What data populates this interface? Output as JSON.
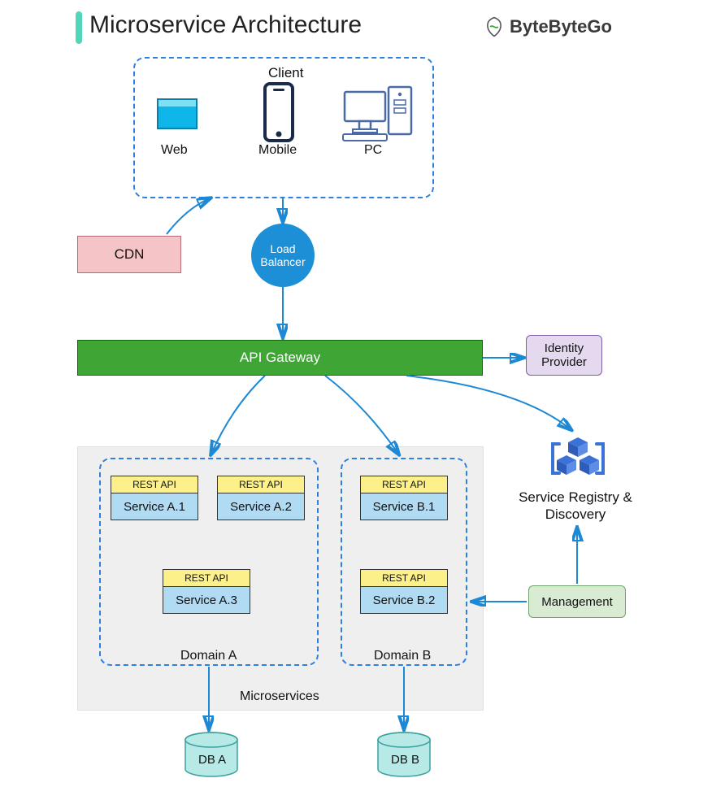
{
  "title": "Microservice Architecture",
  "brand": "ByteByteGo",
  "client": {
    "label": "Client",
    "items": {
      "web": "Web",
      "mobile": "Mobile",
      "pc": "PC"
    }
  },
  "cdn": "CDN",
  "lb": "Load Balancer",
  "api_gateway": "API Gateway",
  "idp": {
    "l1": "Identity",
    "l2": "Provider"
  },
  "microservices_label": "Microservices",
  "rest_api_label": "REST API",
  "domainA": {
    "label": "Domain A",
    "s1": "Service A.1",
    "s2": "Service A.2",
    "s3": "Service A.3"
  },
  "domainB": {
    "label": "Domain B",
    "s1": "Service B.1",
    "s2": "Service B.2"
  },
  "dbA": "DB A",
  "dbB": "DB B",
  "registry": {
    "l1": "Service Registry &",
    "l2": "Discovery"
  },
  "management": "Management"
}
